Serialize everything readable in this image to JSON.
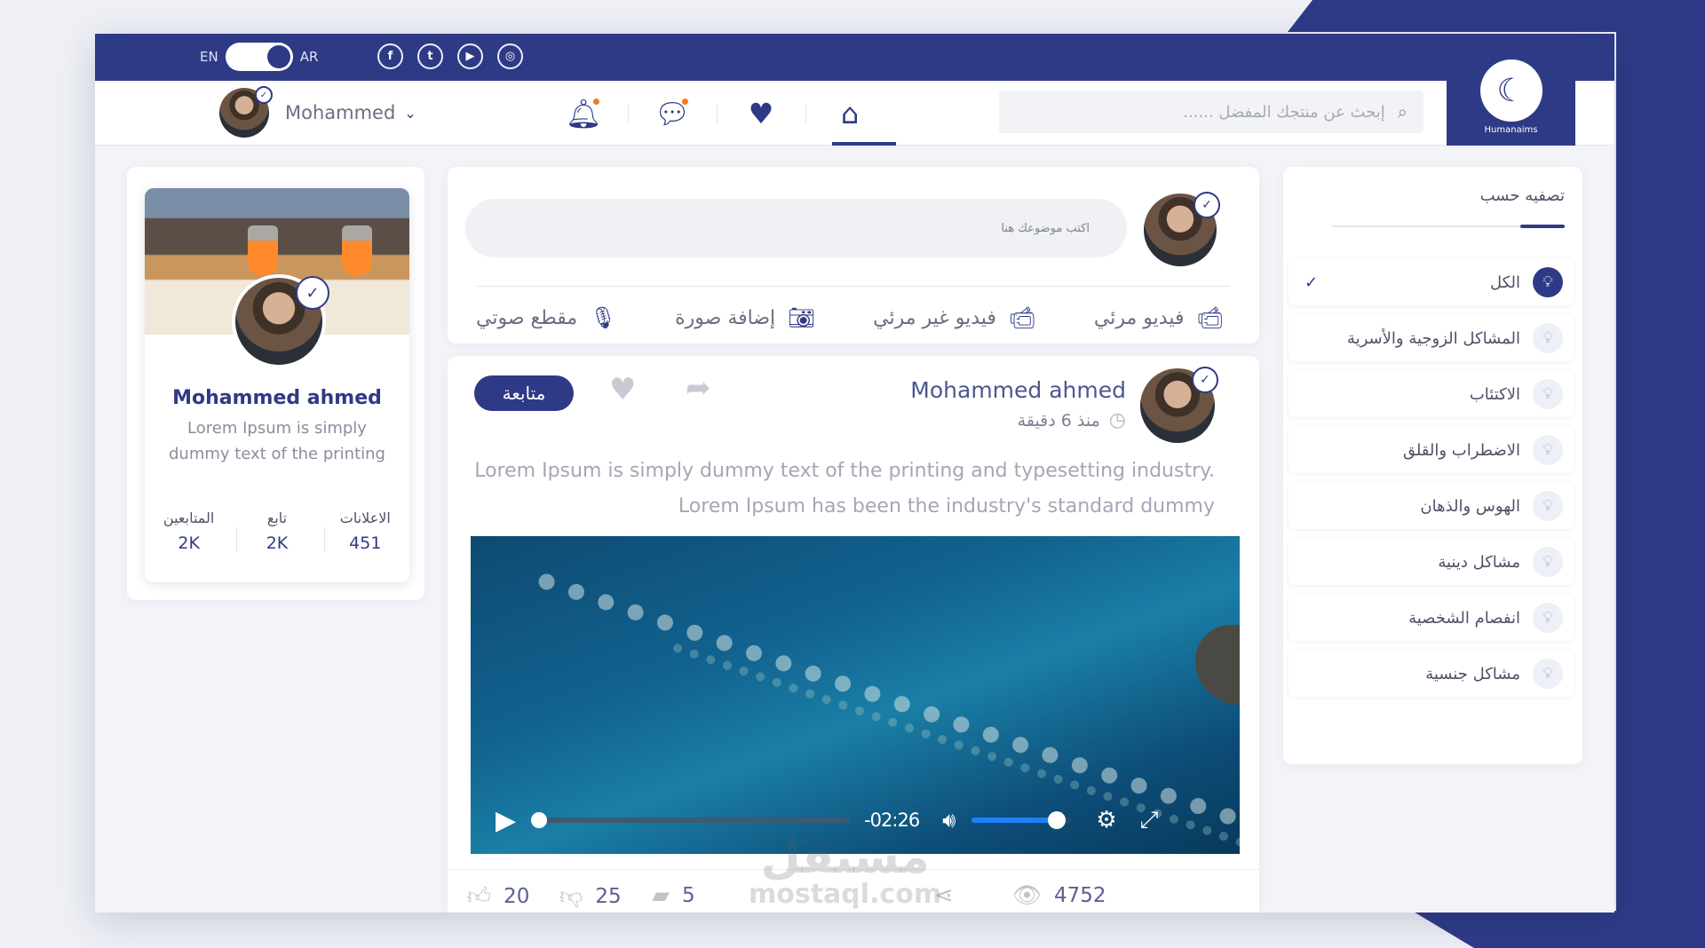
{
  "topbar": {
    "lang_left": "EN",
    "lang_right": "AR",
    "socials": [
      "f",
      "t",
      "▶",
      "◎"
    ]
  },
  "navbar": {
    "user_name": "Mohammed",
    "search_placeholder": "إبحث عن منتجك المفضل ......",
    "logo_text": "Humanaims"
  },
  "profile": {
    "name": "Mohammed ahmed",
    "bio": "Lorem Ipsum is simply dummy text of the printing",
    "stats": [
      {
        "label": "المتابعين",
        "value": "2K"
      },
      {
        "label": "تابع",
        "value": "2K"
      },
      {
        "label": "الاعلانات",
        "value": "451"
      }
    ]
  },
  "composer": {
    "placeholder": "اكتب موضوعك هنا",
    "actions": [
      {
        "label": "مقطع صوتي",
        "icon": "microphone-icon"
      },
      {
        "label": "إضافة صورة",
        "icon": "camera-icon"
      },
      {
        "label": "فيديو غير مرئي",
        "icon": "video-camera-icon"
      },
      {
        "label": "فيديو مرئي",
        "icon": "video-camera-icon"
      }
    ]
  },
  "post": {
    "author": "Mohammed ahmed",
    "time": "منذ 6 دقيقة",
    "follow_label": "متابعة",
    "text": "Lorem Ipsum is simply dummy text of the printing and typesetting industry. Lorem Ipsum has been the industry's standard dummy",
    "video": {
      "time_remaining": "-02:26",
      "progress": 0,
      "volume": 0.85
    },
    "footer": {
      "likes": "20",
      "dislikes": "25",
      "comments": "5",
      "views": "4752"
    }
  },
  "filter": {
    "title": "تصفيه حسب",
    "items": [
      {
        "label": "الكل",
        "selected": true
      },
      {
        "label": "المشاكل الزوجية والأسرية",
        "selected": false
      },
      {
        "label": "الاكتئاب",
        "selected": false
      },
      {
        "label": "الاضطراب والقلق",
        "selected": false
      },
      {
        "label": "الهوس والذهان",
        "selected": false
      },
      {
        "label": "مشاكل دينية",
        "selected": false
      },
      {
        "label": "انفصام الشخصية",
        "selected": false
      },
      {
        "label": "مشاكل جنسية",
        "selected": false
      }
    ]
  },
  "watermark": {
    "main": "مستقل",
    "sub": "mostaql.com"
  },
  "colors": {
    "brand": "#2f3a86",
    "notification": "#f27b21",
    "volume": "#1e7fff"
  }
}
